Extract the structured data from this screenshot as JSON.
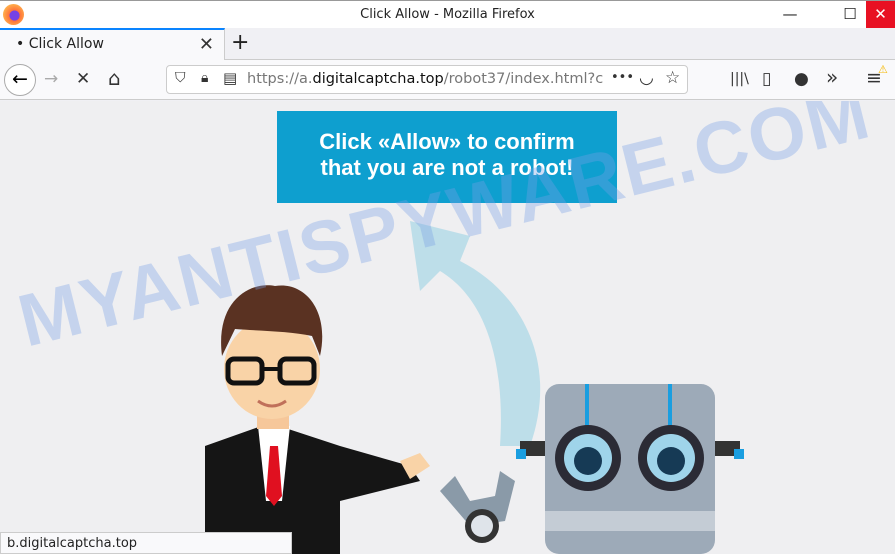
{
  "window": {
    "title": "Click Allow - Mozilla Firefox",
    "minimize": "—",
    "maximize": "☐",
    "close": "✕"
  },
  "tab": {
    "label": "• Click Allow",
    "close": "✕",
    "new_tab": "+"
  },
  "nav": {
    "back": "←",
    "forward": "→",
    "stop": "✕",
    "home": "⌂",
    "url_prefix": "https://a.",
    "url_domain": "digitalcaptcha.top",
    "url_path": "/robot37/index.html?c=",
    "more": "•••",
    "pocket": "◡",
    "bookmark": "☆",
    "library": "|||\\",
    "sidebar": "▯",
    "account": "●",
    "overflow": "»",
    "menu": "≡",
    "menu_badge": "⚠"
  },
  "page": {
    "banner_line1": "Click «Allow» to confirm",
    "banner_line2": "that you are not a robot!",
    "watermark": "MYANTISPYWARE.COM",
    "accent": "#0e9fcf"
  },
  "status": {
    "text": "b.digitalcaptcha.top"
  }
}
